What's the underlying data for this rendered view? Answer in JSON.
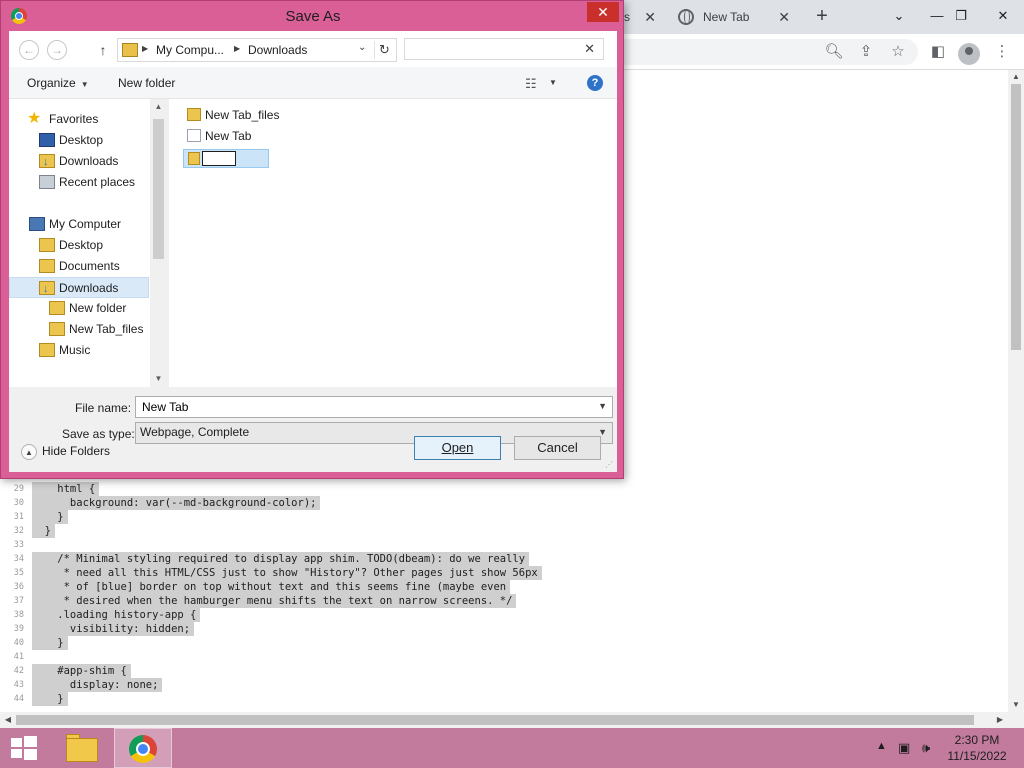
{
  "browser": {
    "partial_tab_label": "s",
    "tab_title": "New Tab",
    "new_tab": "+",
    "window_controls": {
      "dropdown": "⌄",
      "minimize": "—",
      "restore": "❐",
      "close": "✕"
    }
  },
  "code_lines": [
    {
      "n": "29",
      "text": "    html {"
    },
    {
      "n": "30",
      "text": "      background: var(--md-background-color);"
    },
    {
      "n": "31",
      "text": "    }"
    },
    {
      "n": "32",
      "text": "  }"
    },
    {
      "n": "33",
      "text": ""
    },
    {
      "n": "34",
      "text": "    /* Minimal styling required to display app shim. TODO(dbeam): do we really"
    },
    {
      "n": "35",
      "text": "     * need all this HTML/CSS just to show \"History\"? Other pages just show 56px"
    },
    {
      "n": "36",
      "text": "     * of [blue] border on top without text and this seems fine (maybe even"
    },
    {
      "n": "37",
      "text": "     * desired when the hamburger menu shifts the text on narrow screens. */"
    },
    {
      "n": "38",
      "text": "    .loading history-app {"
    },
    {
      "n": "39",
      "text": "      visibility: hidden;"
    },
    {
      "n": "40",
      "text": "    }"
    },
    {
      "n": "41",
      "text": ""
    },
    {
      "n": "42",
      "text": "    #app-shim {"
    },
    {
      "n": "43",
      "text": "      display: none;"
    },
    {
      "n": "44",
      "text": "    }"
    }
  ],
  "dialog": {
    "title": "Save As",
    "close": "✕",
    "address": {
      "crumb1": "My Compu...",
      "crumb2": "Downloads"
    },
    "search": {
      "value": "",
      "placeholder": ""
    },
    "commands": {
      "organize": "Organize",
      "new_folder": "New folder"
    },
    "nav_pane": {
      "favorites": "Favorites",
      "fav_desktop": "Desktop",
      "fav_downloads": "Downloads",
      "fav_recent": "Recent places",
      "my_computer": "My Computer",
      "desktop": "Desktop",
      "documents": "Documents",
      "downloads": "Downloads",
      "new_folder": "New folder",
      "new_tab_files": "New Tab_files",
      "music": "Music"
    },
    "files": {
      "item1": "New Tab_files",
      "item2": "New Tab",
      "new_folder_edit_value": ""
    },
    "file_name_label": "File name:",
    "file_name_value": "New Tab",
    "save_type_label": "Save as type:",
    "save_type_value": "Webpage, Complete",
    "hide_folders": "Hide Folders",
    "open_button": "Open",
    "cancel_button": "Cancel"
  },
  "taskbar": {
    "time": "2:30 PM",
    "date": "11/15/2022"
  },
  "colors": {
    "dialog_frame": "#d95f96",
    "taskbar": "#c27a9d",
    "close_button": "#c9302c",
    "selection": "#d9e9f8"
  }
}
